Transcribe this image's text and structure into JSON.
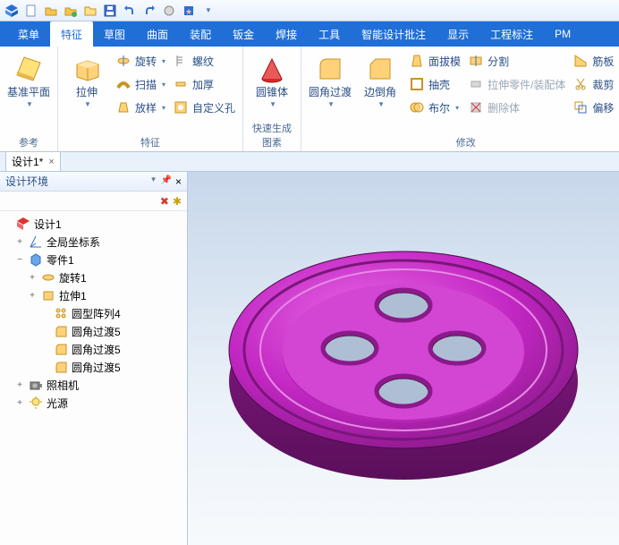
{
  "tabs": [
    "菜单",
    "特征",
    "草图",
    "曲面",
    "装配",
    "钣金",
    "焊接",
    "工具",
    "智能设计批注",
    "显示",
    "工程标注",
    "PM"
  ],
  "active_tab": 1,
  "groups": {
    "reference": {
      "label": "参考",
      "datum_plane": "基准平面"
    },
    "feature": {
      "label": "特征",
      "extrude": "拉伸",
      "revolve": "旋转",
      "thread": "螺纹",
      "sweep": "扫描",
      "thicken": "加厚",
      "loft": "放样",
      "custom_hole": "自定义孔"
    },
    "quickbody": {
      "label": "快速生成图素",
      "cone": "圆锥体"
    },
    "modify": {
      "label": "修改",
      "fillet": "圆角过渡",
      "chamfer": "边倒角",
      "face_draft": "面拔模",
      "split": "分割",
      "shell": "抽壳",
      "stretch_assy": "拉伸零件/装配体",
      "boolean": "布尔",
      "delete_body": "删除体",
      "rib": "筋板",
      "cut": "裁剪",
      "offset": "偏移"
    }
  },
  "doc": {
    "name": "设计1*",
    "close": "×"
  },
  "panel": {
    "title": "设计环境",
    "pin": "📌",
    "close": "×"
  },
  "panel_tool": {
    "del": "✖",
    "new": "✱"
  },
  "tree": [
    {
      "depth": 0,
      "twist": "",
      "icon": "design",
      "label": "设计1"
    },
    {
      "depth": 1,
      "twist": "+",
      "icon": "axis",
      "label": "全局坐标系"
    },
    {
      "depth": 1,
      "twist": "−",
      "icon": "part",
      "label": "零件1"
    },
    {
      "depth": 2,
      "twist": "+",
      "icon": "revolve",
      "label": "旋转1"
    },
    {
      "depth": 2,
      "twist": "+",
      "icon": "extrude",
      "label": "拉伸1"
    },
    {
      "depth": 3,
      "twist": "",
      "icon": "pattern",
      "label": "圆型阵列4"
    },
    {
      "depth": 3,
      "twist": "",
      "icon": "fillet",
      "label": "圆角过渡5"
    },
    {
      "depth": 3,
      "twist": "",
      "icon": "fillet",
      "label": "圆角过渡5"
    },
    {
      "depth": 3,
      "twist": "",
      "icon": "fillet",
      "label": "圆角过渡5"
    },
    {
      "depth": 1,
      "twist": "+",
      "icon": "camera",
      "label": "照相机"
    },
    {
      "depth": 1,
      "twist": "+",
      "icon": "light",
      "label": "光源"
    }
  ],
  "colors": {
    "accent": "#1f6fd6",
    "model": "#c226c2"
  }
}
